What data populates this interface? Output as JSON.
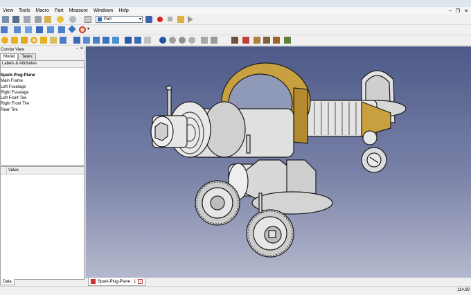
{
  "menu": {
    "items": [
      "View",
      "Tools",
      "Macro",
      "Part",
      "Measure",
      "Windows",
      "Help"
    ]
  },
  "toolbar": {
    "workbench_selected": "Part"
  },
  "combo_view": {
    "title": "Combo View",
    "tabs": [
      "Model",
      "Tasks"
    ],
    "tree_header": "Labels & Attributes",
    "tree_items": [
      "Spark-Plug-Plane",
      "Main Frame",
      "Left Fuselage",
      "Right Fuselage",
      "Left Front Tire",
      "Right Front Tire",
      "Rear Tire"
    ],
    "property_header": "Value",
    "bottom_tab": "Data"
  },
  "document": {
    "tab_label": "Spark-Plug-Plane : 1"
  },
  "status": {
    "coordinates": "114.89"
  },
  "colors": {
    "view_top": "#4d5a88",
    "view_bottom": "#b5b9cd",
    "gold_part": "#c9a040",
    "metal": "#d8d8d8"
  }
}
